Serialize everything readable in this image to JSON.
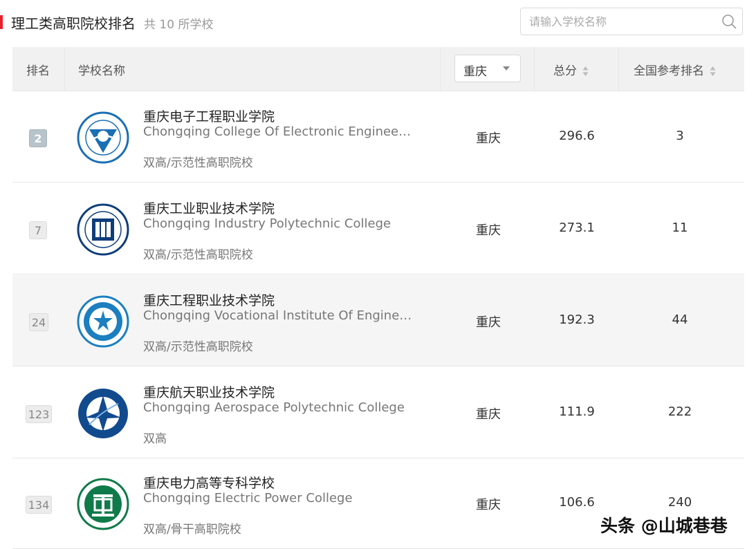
{
  "header": {
    "title": "理工类高职院校排名",
    "count": "共 10 所学校",
    "accent_color": "#e8202b"
  },
  "search": {
    "placeholder": "请输入学校名称",
    "value": "",
    "icon": "search-icon"
  },
  "table": {
    "columns": {
      "rank": "排名",
      "school": "学校名称",
      "city_filter": "重庆",
      "score": "总分",
      "national_rank": "全国参考排名"
    },
    "rows": [
      {
        "rank": "2",
        "name_cn": "重庆电子工程职业学院",
        "name_en": "Chongqing College Of Electronic Engineering",
        "tags": "双高/示范性高职院校",
        "city": "重庆",
        "score": "296.6",
        "national_rank": "3",
        "logo_icon": "school-emblem-icon",
        "logo_color": "#1a6fb5"
      },
      {
        "rank": "7",
        "name_cn": "重庆工业职业技术学院",
        "name_en": "Chongqing Industry Polytechnic College",
        "tags": "双高/示范性高职院校",
        "city": "重庆",
        "score": "273.1",
        "national_rank": "11",
        "logo_icon": "school-emblem-icon",
        "logo_color": "#0e3d7a"
      },
      {
        "rank": "24",
        "name_cn": "重庆工程职业技术学院",
        "name_en": "Chongqing Vocational Institute Of Engineeri...",
        "tags": "双高/示范性高职院校",
        "city": "重庆",
        "score": "192.3",
        "national_rank": "44",
        "logo_icon": "school-emblem-icon",
        "logo_color": "#1b7fc0"
      },
      {
        "rank": "123",
        "name_cn": "重庆航天职业技术学院",
        "name_en": "Chongqing Aerospace Polytechnic College",
        "tags": "双高",
        "city": "重庆",
        "score": "111.9",
        "national_rank": "222",
        "logo_icon": "school-emblem-icon",
        "logo_color": "#124a8e"
      },
      {
        "rank": "134",
        "name_cn": "重庆电力高等专科学校",
        "name_en": "Chongqing Electric Power College",
        "tags": "双高/骨干高职院校",
        "city": "重庆",
        "score": "106.6",
        "national_rank": "240",
        "logo_icon": "school-emblem-icon",
        "logo_color": "#0f7a4a"
      }
    ]
  },
  "watermark": "头条 @山城巷巷"
}
